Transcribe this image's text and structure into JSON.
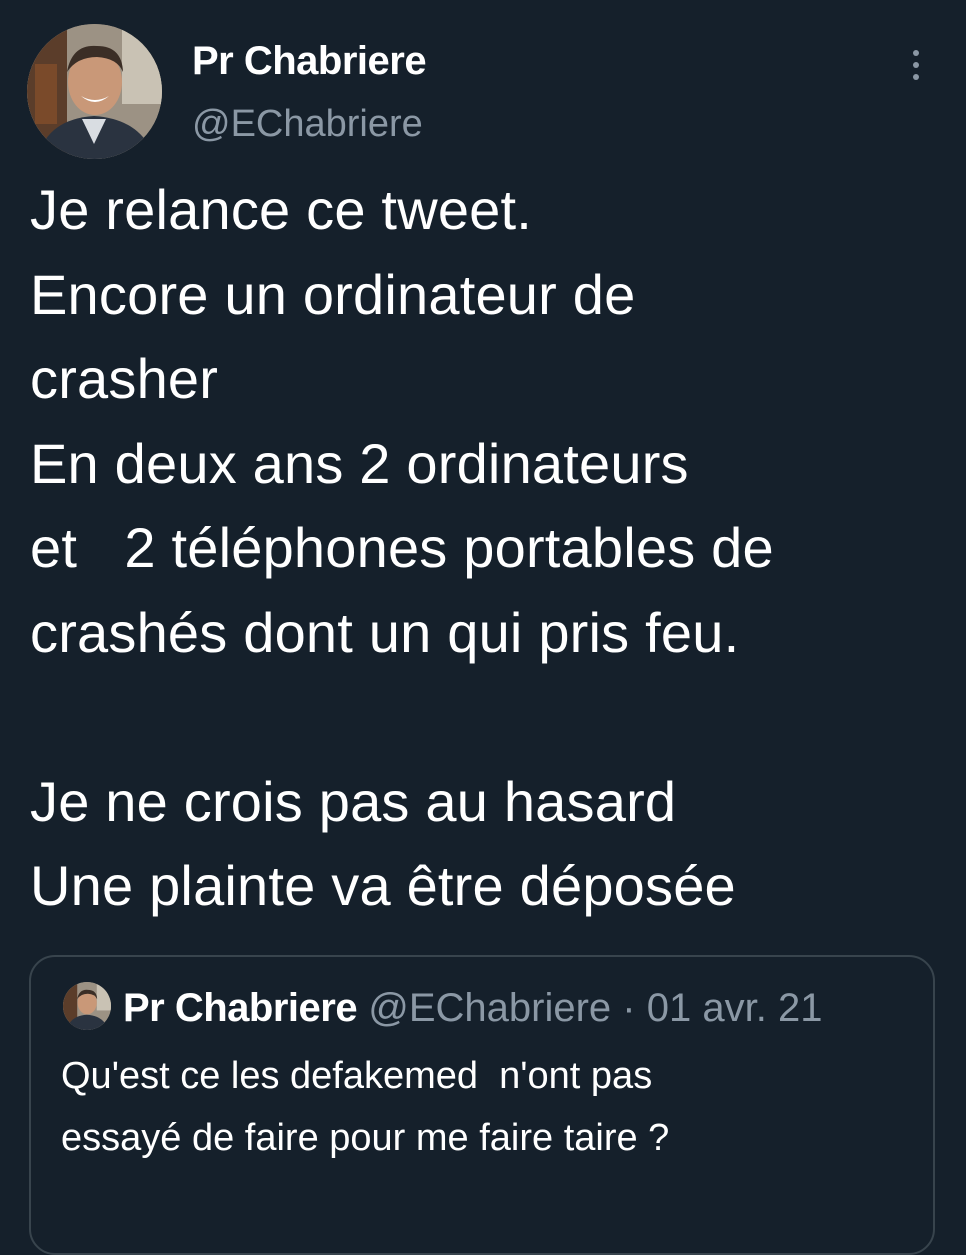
{
  "tweet": {
    "author": {
      "display_name": "Pr Chabriere",
      "handle": "@EChabriere"
    },
    "more_icon": "more-vertical-icon",
    "text": "Je relance ce tweet.\nEncore un ordinateur de\ncrasher\nEn deux ans 2 ordinateurs\net   2 téléphones portables de\ncrashés dont un qui pris feu.\n\nJe ne crois pas au hasard\nUne plainte va être déposée"
  },
  "quoted_tweet": {
    "display_name": "Pr Chabriere",
    "handle": "@EChabriere",
    "separator": "·",
    "date": "01 avr. 21",
    "text": "Qu'est ce les defakemed  n'ont pas\nessayé de faire pour me faire taire ?"
  },
  "colors": {
    "background": "#15202b",
    "primary_text": "#ffffff",
    "secondary_text": "#8b98a5",
    "border": "#38444d"
  }
}
